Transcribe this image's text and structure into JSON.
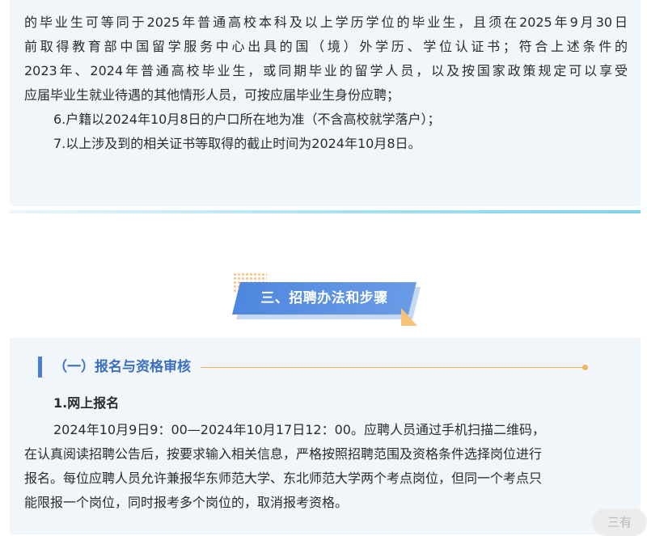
{
  "requirements": {
    "lines": [
      "的毕业生可等同于2025年普通高校本科及以上学历学位的毕业生，且须在2025年9月30日",
      "前取得教育部中国留学服务中心出具的国（境）外学历、学位认证书；符合上述条件的",
      "2023年、2024年普通高校毕业生，或同期毕业的留学人员，以及按国家政策规定可以享受",
      "应届毕业生就业待遇的其他情形人员，可按应届毕业生身份应聘；"
    ],
    "item6": "6.户籍以2024年10月8日的户口所在地为准（不含高校就学落户）；",
    "item7": "7.以上涉及到的相关证书等取得的截止时间为2024年10月8日。"
  },
  "section": {
    "title": "三、招聘办法和步骤",
    "subsection_title": "（一）报名与资格审核",
    "step_title": "1.网上报名",
    "step_lines": [
      "2024年10月9日9：00—2024年10月17日12：00。应聘人员通过手机扫描二维码，",
      "在认真阅读招聘公告后，按要求输入相关信息，严格按照招聘范围及资格条件选择岗位进行",
      "报名。每位应聘人员允许兼报华东师范大学、东北师范大学两个考点岗位，但同一个考点只",
      "能限报一个岗位，同时报考多个岗位的，取消报考资格。"
    ]
  },
  "watermark": "三有",
  "colors": {
    "accent_blue": "#4f87df",
    "accent_orange": "#f0b45a",
    "card_bg": "#f1f6fb"
  }
}
